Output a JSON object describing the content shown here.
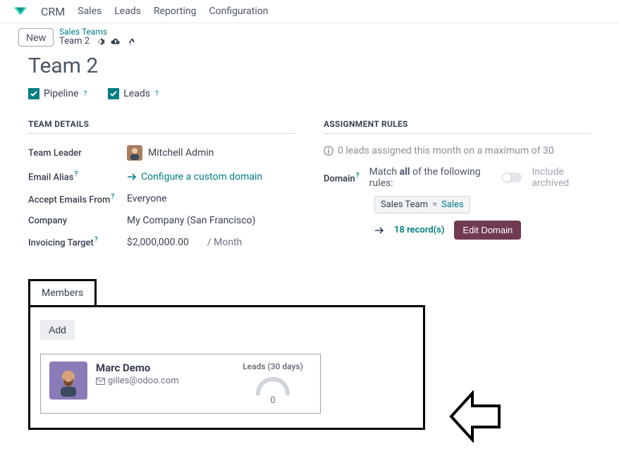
{
  "nav": {
    "app": "CRM",
    "items": [
      "Sales",
      "Leads",
      "Reporting",
      "Configuration"
    ]
  },
  "crumb": {
    "new_label": "New",
    "parent": "Sales Teams",
    "current": "Team 2"
  },
  "page_title": "Team 2",
  "checks": {
    "pipeline": "Pipeline",
    "leads": "Leads"
  },
  "sections": {
    "team_details": "TEAM DETAILS",
    "assignment_rules": "ASSIGNMENT RULES"
  },
  "team": {
    "leader_label": "Team Leader",
    "leader_value": "Mitchell Admin",
    "email_alias_label": "Email Alias",
    "configure_domain": "Configure a custom domain",
    "accept_from_label": "Accept Emails From",
    "accept_from_value": "Everyone",
    "company_label": "Company",
    "company_value": "My Company (San Francisco)",
    "invoicing_label": "Invoicing Target",
    "invoicing_value": "$2,000,000.00",
    "invoicing_unit": "/ Month"
  },
  "assign": {
    "info": "0 leads assigned this month on a maximum of 30",
    "domain_label": "Domain",
    "match_prefix": "Match ",
    "match_bold": "all",
    "match_suffix": " of the following rules:",
    "include_archived": "Include archived",
    "rule_field": "Sales Team",
    "rule_op": "=",
    "rule_value": "Sales",
    "records": "18 record(s)",
    "edit_btn": "Edit Domain"
  },
  "members": {
    "tab": "Members",
    "add": "Add",
    "card": {
      "name": "Marc Demo",
      "email": "gilles@odoo.com",
      "stats_label": "Leads (30 days)",
      "stats_value": "0"
    }
  }
}
